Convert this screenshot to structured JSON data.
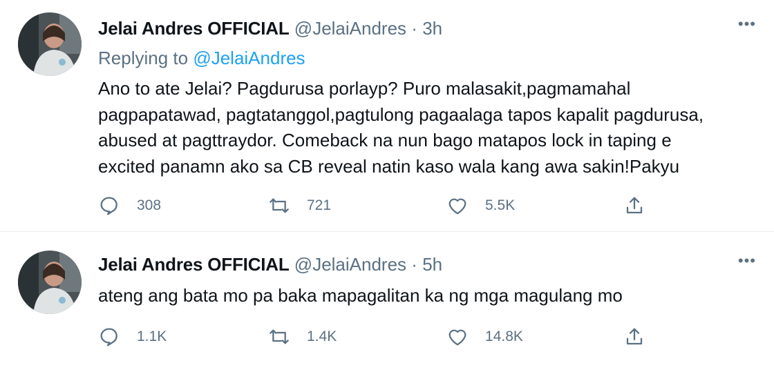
{
  "tweets": [
    {
      "author_name": "Jelai Andres OFFICIAL",
      "handle": "@JelaiAndres",
      "separator": "·",
      "time": "3h",
      "replying_prefix": "Replying to",
      "replying_to": "@JelaiAndres",
      "text_lines": [
        "Ano to ate Jelai? Pagdurusa porlayp? Puro malasakit,pagmamahal",
        "pagpapatawad, pagtatanggol,pagtulong pagaalaga tapos kapalit pagdurusa,",
        "abused at pagttraydor. Comeback na nun bago matapos lock in taping e",
        "excited panamn ako sa CB reveal natin kaso wala kang awa sakin!Pakyu"
      ],
      "stats": {
        "replies": "308",
        "retweets": "721",
        "likes": "5.5K"
      },
      "more_icon": "more-horizontal-icon"
    },
    {
      "author_name": "Jelai Andres OFFICIAL",
      "handle": "@JelaiAndres",
      "separator": "·",
      "time": "5h",
      "text_lines": [
        "ateng ang bata mo pa baka mapagalitan ka ng mga magulang mo"
      ],
      "stats": {
        "replies": "1.1K",
        "retweets": "1.4K",
        "likes": "14.8K"
      },
      "more_icon": "more-horizontal-icon"
    }
  ],
  "icons": {
    "reply": "comment-icon",
    "retweet": "retweet-icon",
    "like": "heart-icon",
    "share": "share-icon"
  },
  "colors": {
    "primary_text": "#0f1419",
    "secondary_text": "#5b7083",
    "link": "#1da1f2",
    "divider": "#e6ecf0"
  }
}
